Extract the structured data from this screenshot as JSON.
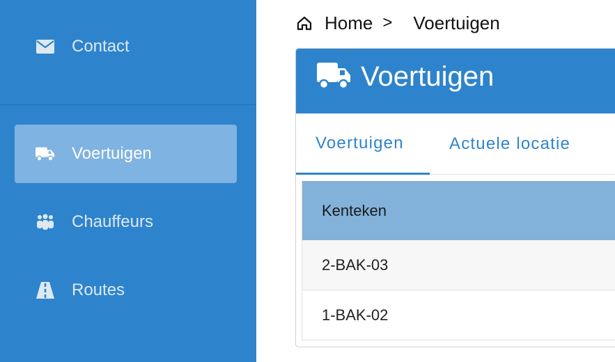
{
  "sidebar": {
    "items": [
      {
        "label": "Contact",
        "icon": "envelope-icon",
        "active": false
      },
      {
        "label": "Voertuigen",
        "icon": "truck-icon",
        "active": true
      },
      {
        "label": "Chauffeurs",
        "icon": "users-icon",
        "active": false
      },
      {
        "label": "Routes",
        "icon": "road-icon",
        "active": false
      }
    ]
  },
  "breadcrumb": {
    "home": "Home",
    "separator": ">",
    "current": "Voertuigen"
  },
  "panel": {
    "title": "Voertuigen",
    "tabs": [
      {
        "label": "Voertuigen",
        "active": true
      },
      {
        "label": "Actuele locatie",
        "active": false
      }
    ],
    "table": {
      "columns": [
        "Kenteken"
      ],
      "rows": [
        [
          "2-BAK-03"
        ],
        [
          "1-BAK-02"
        ]
      ]
    }
  },
  "colors": {
    "primary": "#2e84cc",
    "active_nav": "#7fb3e1",
    "table_header": "#82b2da"
  }
}
